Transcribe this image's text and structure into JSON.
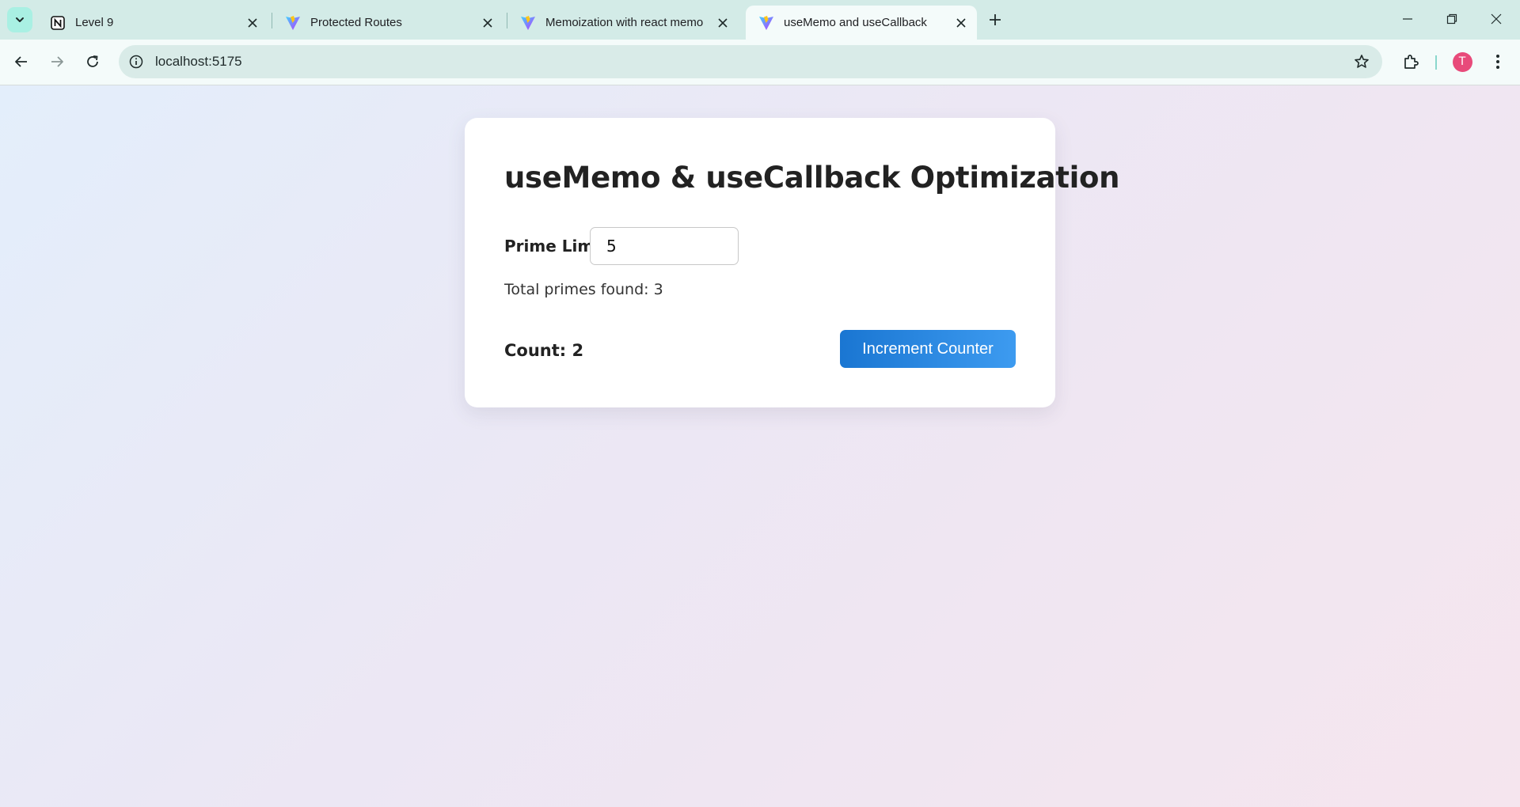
{
  "browser": {
    "tabs": [
      {
        "title": "Level 9",
        "favicon": "notion-icon",
        "active": false
      },
      {
        "title": "Protected Routes",
        "favicon": "vite-icon",
        "active": false
      },
      {
        "title": "Memoization with react memo",
        "favicon": "vite-icon",
        "active": false
      },
      {
        "title": "useMemo and useCallback",
        "favicon": "vite-icon",
        "active": true
      }
    ],
    "url": "localhost:5175",
    "profile_initial": "T",
    "colors": {
      "tabstrip": "#d3ebe7",
      "active_tab": "#f4fbfa",
      "avatar": "#e84a7a"
    }
  },
  "app": {
    "title": "useMemo & useCallback Optimization",
    "prime_label": "Prime Limit:",
    "prime_value": "5",
    "total_text": "Total primes found: 3",
    "count_text": "Count: 2",
    "increment_label": "Increment Counter",
    "colors": {
      "button_start": "#1a76d2",
      "button_end": "#3d9bf0"
    }
  }
}
